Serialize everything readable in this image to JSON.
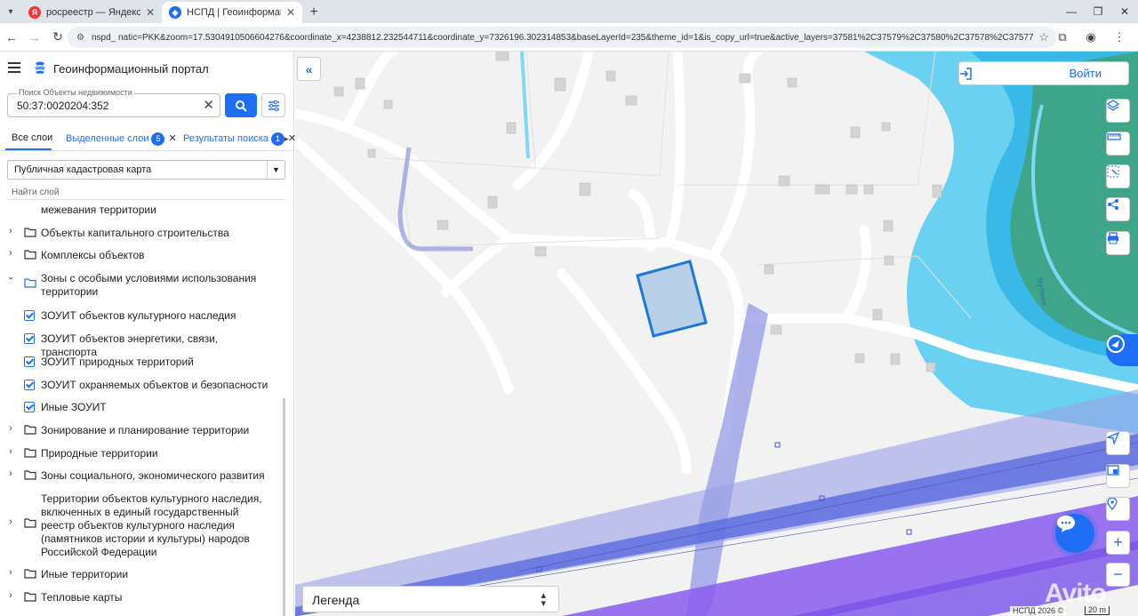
{
  "browser": {
    "tabs": [
      {
        "title": "росреестр — Яндекс: нашлось",
        "favicon": "yandex-icon",
        "active": false
      },
      {
        "title": "НСПД | Геоинформационный",
        "favicon": "nspd-icon",
        "active": true
      }
    ],
    "url_site": "nspd",
    "url": "nspd_            natic=PKK&zoom=17.5304910506604276&coordinate_x=4238812.232544711&coordinate_y=7326196.302314853&baseLayerId=235&theme_id=1&is_copy_url=true&active_layers=37581%2C37579%2C37580%2C37578%2C37577"
  },
  "panel": {
    "title": "Геоинформационный портал",
    "search": {
      "label": "Поиск Объекты недвижимости",
      "value": "50:37:0020204:352"
    },
    "tabs": {
      "all": "Все слои",
      "selected": "Выделенные слои",
      "selected_count": "5",
      "results": "Результаты поиска",
      "results_count": "1"
    },
    "basemap": "Публичная кадастровая карта",
    "find_layer": "Найти слой",
    "tree": [
      {
        "label": "межевания территории",
        "kind": "tail"
      },
      {
        "label": "Объекты капитального строительства",
        "kind": "folder"
      },
      {
        "label": "Комплексы объектов",
        "kind": "folder"
      },
      {
        "label": "Зоны с особыми условиями использования территории",
        "kind": "folder-open"
      },
      {
        "label": "ЗОУИТ объектов культурного наследия",
        "kind": "check"
      },
      {
        "label": "ЗОУИТ объектов энергетики, связи, транспорта",
        "kind": "check"
      },
      {
        "label": "ЗОУИТ природных территорий",
        "kind": "check"
      },
      {
        "label": "ЗОУИТ охраняемых объектов и безопасности",
        "kind": "check"
      },
      {
        "label": "Иные ЗОУИТ",
        "kind": "check"
      },
      {
        "label": "Зонирование и планирование территории",
        "kind": "folder"
      },
      {
        "label": "Природные территории",
        "kind": "folder"
      },
      {
        "label": "Зоны социального, экономического развития",
        "kind": "folder"
      },
      {
        "label": "Территории объектов культурного наследия, включенных в единый государственный реестр объектов культурного наследия (памятников истории и культуры) народов Российской Федерации",
        "kind": "folder"
      },
      {
        "label": "Иные территории",
        "kind": "folder"
      },
      {
        "label": "Тепловые карты",
        "kind": "folder"
      }
    ]
  },
  "map": {
    "login": "Войти",
    "legend": "Легенда",
    "copyright": "НСПД 2026 ©",
    "scale": "20 m",
    "river_label": "Мутенка",
    "watermark": "Avito",
    "colors": {
      "accent": "#1e6ef5",
      "parcel": "#2b78d8",
      "water": "#3fc6f0",
      "forest": "#3fa58a",
      "zone_purple": "#8a5cf0"
    }
  }
}
